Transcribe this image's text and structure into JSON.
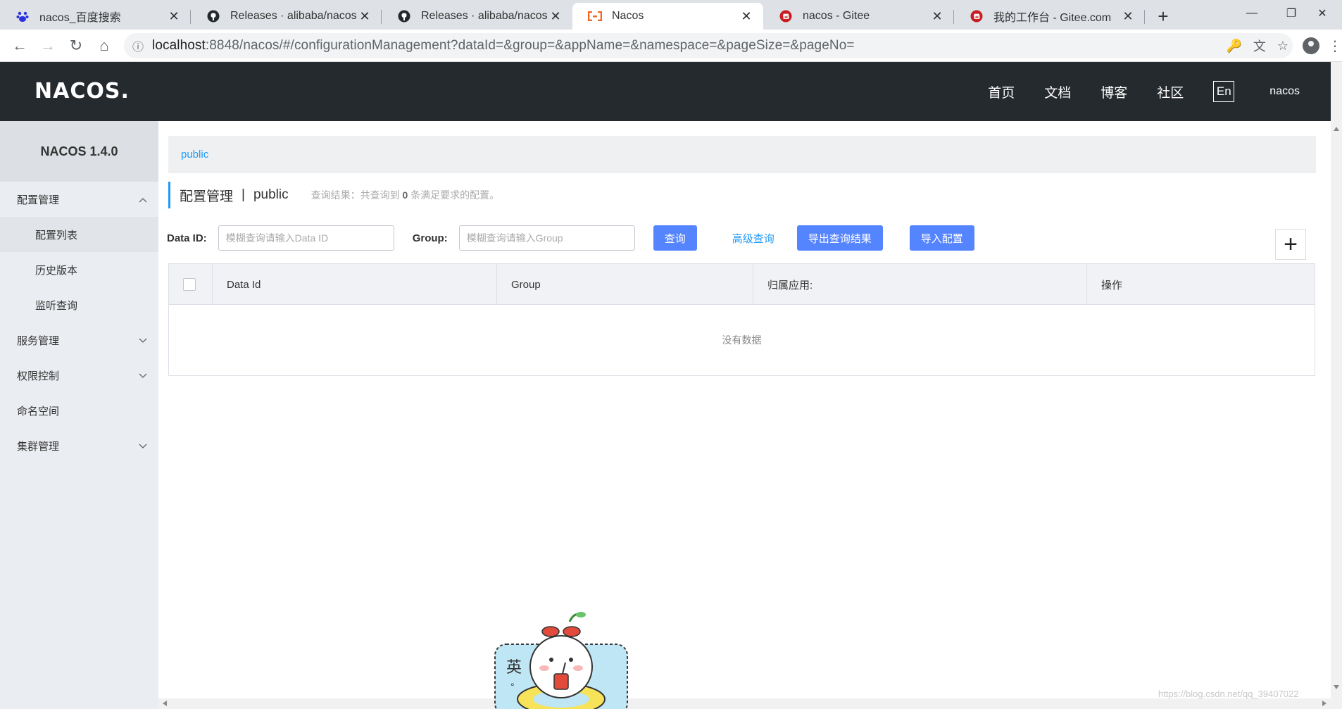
{
  "browser": {
    "tabs": [
      {
        "title": "nacos_百度搜索",
        "icon": "baidu-icon",
        "active": false
      },
      {
        "title": "Releases · alibaba/nacos",
        "icon": "github-icon",
        "active": false
      },
      {
        "title": "Releases · alibaba/nacos",
        "icon": "github-icon",
        "active": false
      },
      {
        "title": "Nacos",
        "icon": "nacos-icon",
        "active": true
      },
      {
        "title": "nacos - Gitee",
        "icon": "gitee-icon",
        "active": false
      },
      {
        "title": "我的工作台 - Gitee.com",
        "icon": "gitee-icon",
        "active": false
      }
    ],
    "url_host": "localhost",
    "url_rest": ":8848/nacos/#/configurationManagement?dataId=&group=&appName=&namespace=&pageSize=&pageNo="
  },
  "header": {
    "logo": "NACOS.",
    "nav": [
      "首页",
      "文档",
      "博客",
      "社区"
    ],
    "lang": "En",
    "user": "nacos"
  },
  "sidebar": {
    "version": "NACOS 1.4.0",
    "config": "配置管理",
    "config_items": [
      "配置列表",
      "历史版本",
      "监听查询"
    ],
    "service": "服务管理",
    "auth": "权限控制",
    "namespace": "命名空间",
    "cluster": "集群管理"
  },
  "main": {
    "namespace_link": "public",
    "title": "配置管理",
    "title_sep": "|",
    "title_ns": "public",
    "hint_prefix": "查询结果：共查询到",
    "hint_count": "0",
    "hint_suffix": "条满足要求的配置。",
    "dataid_label": "Data ID:",
    "dataid_placeholder": "模糊查询请输入Data ID",
    "group_label": "Group:",
    "group_placeholder": "模糊查询请输入Group",
    "query_btn": "查询",
    "advanced_link": "高级查询",
    "export_btn": "导出查询结果",
    "import_btn": "导入配置",
    "columns": [
      "Data Id",
      "Group",
      "归属应用:",
      "操作"
    ],
    "empty_text": "没有数据"
  },
  "watermark": "https://blog.csdn.net/qq_39407022"
}
